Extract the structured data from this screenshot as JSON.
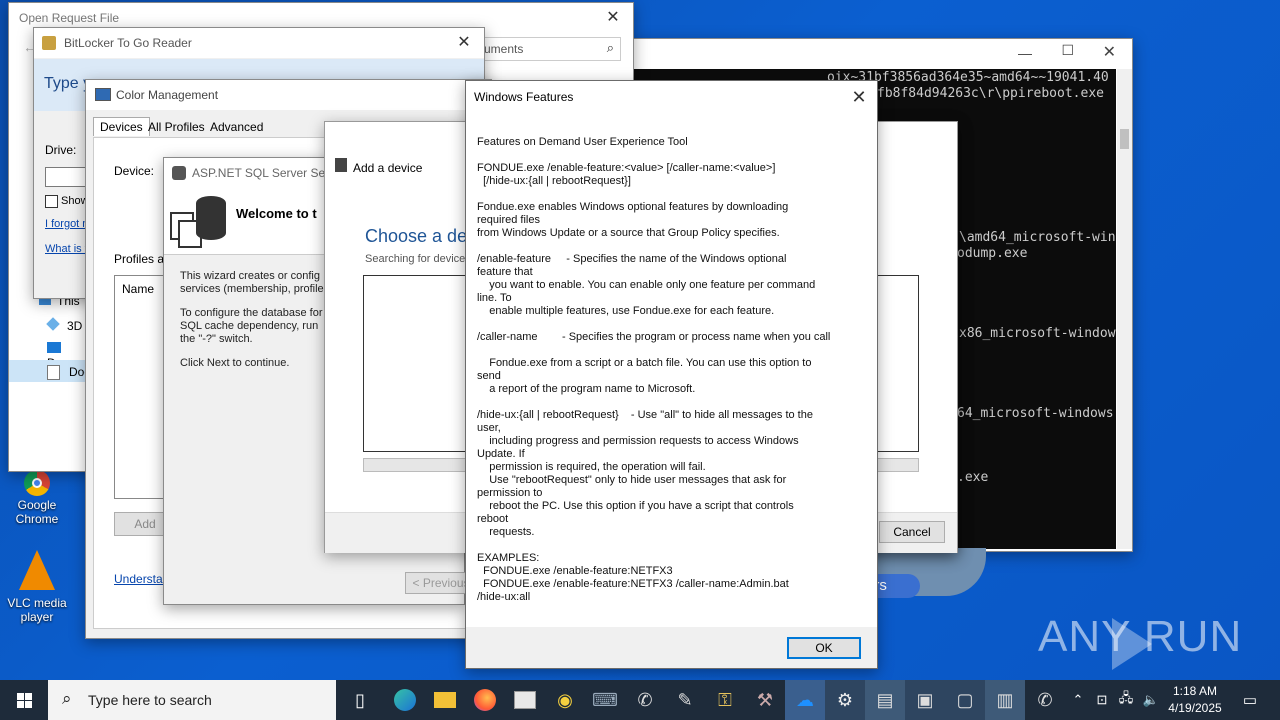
{
  "desktop_icons": [
    {
      "label": "Google Chrome",
      "icon": "chrome-icon"
    },
    {
      "label": "VLC media player",
      "icon": "vlc-icon"
    }
  ],
  "open_request": {
    "title": "Open Request File",
    "search_placeholder": "uments",
    "nav_items": [
      "This",
      "3D",
      "Des",
      "Doc"
    ]
  },
  "bitlocker": {
    "title": "BitLocker To Go Reader",
    "heading": "Type y",
    "drive_label": "Drive:",
    "show_label": "Show",
    "link_forgot": "I forgot n",
    "link_what": "What is t"
  },
  "color_mgmt": {
    "title": "Color Management",
    "tabs": [
      "Devices",
      "All Profiles",
      "Advanced"
    ],
    "device_label": "Device:",
    "profiles_label": "Profiles a",
    "name_col": "Name",
    "add_btn": "Add",
    "understand_link": "Understar"
  },
  "aspnet": {
    "title": "ASP.NET SQL Server Setup",
    "welcome": "Welcome to t",
    "p1a": "This wizard creates or config",
    "p1b": "services (membership, profile",
    "p2a": "To configure the database for",
    "p2b": "SQL cache dependency, run",
    "p2c": "the \"-?\" switch.",
    "p3": "Click Next to continue.",
    "prev_btn": "< Previous"
  },
  "add_device": {
    "title": "Add a device",
    "heading": "Choose a devi",
    "searching": "Searching for device",
    "progress": 0.55,
    "cancel_btn": "Cancel"
  },
  "cmd": {
    "lines": [
      {
        "text": "oix~31bf3856ad364e35~amd64~~19041.40"
      },
      {
        "text": "fb8f84d94263c\\r\\ppireboot.exe"
      },
      {
        "text": "\\amd64_microsoft-win"
      },
      {
        "text": "odump.exe"
      },
      {
        "text": "x86_microsoft-window"
      },
      {
        "text": "64_microsoft-windows"
      },
      {
        "text": ".exe"
      }
    ]
  },
  "partial_btn": "ers",
  "windows_features": {
    "title": "Windows Features",
    "lines": [
      "Features on Demand User Experience Tool",
      "",
      "FONDUE.exe /enable-feature:<value> [/caller-name:<value>]",
      "  [/hide-ux:{all | rebootRequest}]",
      "",
      "Fondue.exe enables Windows optional features by downloading",
      "required files",
      "from Windows Update or a source that Group Policy specifies.",
      "",
      "/enable-feature     - Specifies the name of the Windows optional",
      "feature that",
      "    you want to enable. You can enable only one feature per command",
      "line. To",
      "    enable multiple features, use Fondue.exe for each feature.",
      "",
      "/caller-name        - Specifies the program or process name when you call",
      "",
      "    Fondue.exe from a script or a batch file. You can use this option to",
      "send",
      "    a report of the program name to Microsoft.",
      "",
      "/hide-ux:{all | rebootRequest}    - Use \"all\" to hide all messages to the",
      "user,",
      "    including progress and permission requests to access Windows",
      "Update. If",
      "    permission is required, the operation will fail.",
      "    Use \"rebootRequest\" only to hide user messages that ask for",
      "permission to",
      "    reboot the PC. Use this option if you have a script that controls",
      "reboot",
      "    requests.",
      "",
      "EXAMPLES:",
      "  FONDUE.exe /enable-feature:NETFX3",
      "  FONDUE.exe /enable-feature:NETFX3 /caller-name:Admin.bat",
      "/hide-ux:all"
    ],
    "ok_btn": "OK"
  },
  "taskbar": {
    "search_placeholder": "Type here to search",
    "time": "1:18 AM",
    "date": "4/19/2025"
  },
  "watermark": "ANY RUN"
}
